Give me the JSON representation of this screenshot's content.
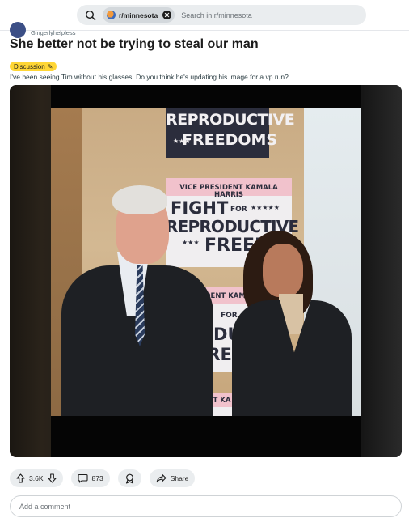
{
  "search": {
    "subreddit_chip": "r/minnesota",
    "placeholder": "Search in r/minnesota"
  },
  "post": {
    "author": "Gingerlyhelpless",
    "title": "She better not be trying to steal our man",
    "flair": "Discussion",
    "body": "I've been seeing Tim without his glasses. Do you think he's updating his image for a vp run?"
  },
  "image": {
    "signs": {
      "top_line1": "REPRODUCTIVE",
      "top_line2": "FREEDOMS",
      "mid_header": "VICE PRESIDENT KAMALA HARRIS",
      "mid_line1": "FIGHT",
      "mid_for": "FOR",
      "mid_line2": "REPRODUCTIVE",
      "mid_line3": "FREEDO",
      "low_header": "PRESIDENT KAMA",
      "low_line1": "HT",
      "low_for": "FOR",
      "low_line2": "RODU",
      "low_line3": "FRE",
      "bottom_header": "ENT KA"
    }
  },
  "actions": {
    "vote_count": "3.6K",
    "comment_count": "873",
    "share_label": "Share"
  },
  "comment_box": {
    "placeholder": "Add a comment"
  },
  "colors": {
    "flair": "#ffd635",
    "search_bg": "#eaedef",
    "pill_bg": "#eaedef"
  },
  "icons": [
    "search-icon",
    "close-icon",
    "upvote-icon",
    "downvote-icon",
    "comment-icon",
    "award-icon",
    "share-icon"
  ]
}
